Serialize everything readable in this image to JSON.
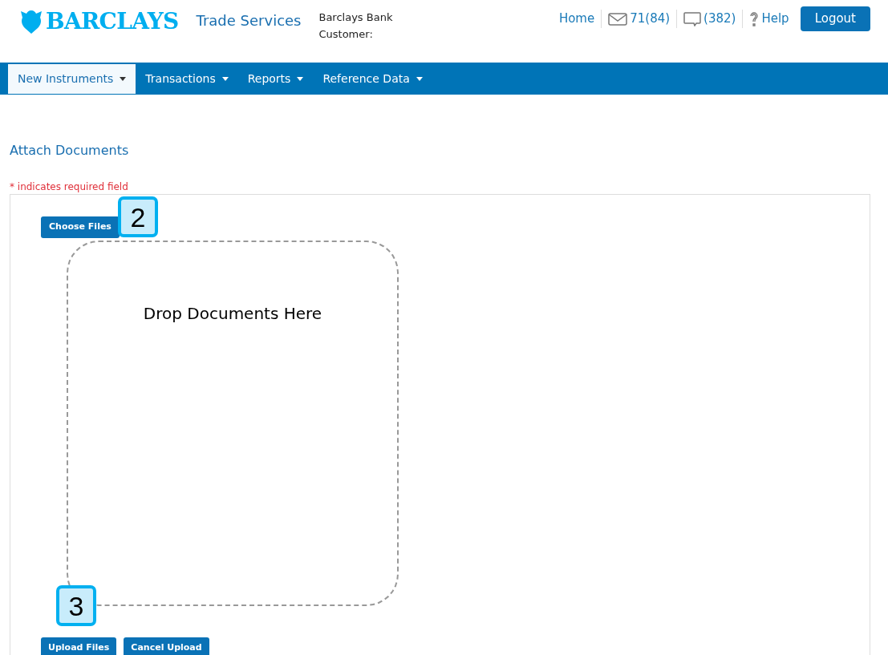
{
  "header": {
    "logo": "BARCLAYS",
    "app_title": "Trade Services",
    "bank": "Barclays Bank",
    "customer_label": "Customer:",
    "links": [
      {
        "kind": "home",
        "label": "Home"
      },
      {
        "kind": "mail",
        "label": "71(84)"
      },
      {
        "kind": "chat",
        "label": "(382)"
      },
      {
        "kind": "help",
        "label": "Help"
      }
    ],
    "logout": "Logout"
  },
  "nav": [
    {
      "label": "New Instruments",
      "selected": true
    },
    {
      "label": "Transactions",
      "selected": false
    },
    {
      "label": "Reports",
      "selected": false
    },
    {
      "label": "Reference Data",
      "selected": false
    }
  ],
  "page_title": "Attach Documents",
  "required_note": "* indicates required field",
  "choose_button": "Choose Files",
  "dropzone": "Drop Documents Here",
  "buttons": [
    "Upload Files",
    "Cancel Upload"
  ],
  "callouts": [
    "2",
    "3"
  ]
}
